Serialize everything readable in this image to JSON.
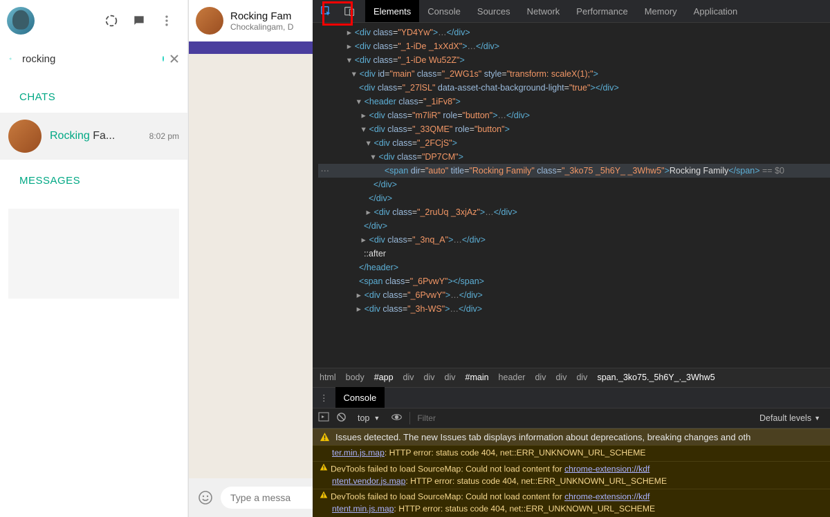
{
  "whatsapp": {
    "search": {
      "value": "rocking"
    },
    "sections": {
      "chats": "CHATS",
      "messages": "MESSAGES"
    },
    "chatItem": {
      "prefix": "Rocking",
      "rest": " Fa...",
      "time": "8:02 pm"
    },
    "openChat": {
      "title": "Rocking Fam",
      "subtitle": "Chockalingam, D"
    },
    "input": {
      "placeholder": "Type a messa"
    }
  },
  "devtools": {
    "tabs": [
      "Elements",
      "Console",
      "Sources",
      "Network",
      "Performance",
      "Memory",
      "Application"
    ],
    "activeTab": "Elements",
    "breadcrumb": [
      "html",
      "body",
      "#app",
      "div",
      "div",
      "div",
      "#main",
      "header",
      "div",
      "div",
      "div",
      "span._3ko75._5h6Y_._3Whw5"
    ],
    "breadcrumbHighlight": [
      2,
      6,
      11
    ],
    "drawerTab": "Console",
    "consoleCtrl": {
      "context": "top",
      "filterPlaceholder": "Filter",
      "levels": "Default levels"
    },
    "issue": "Issues detected. The new Issues tab displays information about deprecations, breaking changes and oth",
    "warnings": [
      {
        "linkPre": "ter.min.js.map",
        "msg": ": HTTP error: status code 404, net::ERR_UNKNOWN_URL_SCHEME"
      },
      {
        "full": "DevTools failed to load SourceMap: Could not load content for ",
        "link": "chrome-extension://kdf",
        "cont": "ntent.vendor.js.map",
        "msg": ": HTTP error: status code 404, net::ERR_UNKNOWN_URL_SCHEME"
      },
      {
        "full": "DevTools failed to load SourceMap: Could not load content for ",
        "link": "chrome-extension://kdf",
        "cont": "ntent.min.js.map",
        "msg": ": HTTP error: status code 404, net::ERR_UNKNOWN_URL_SCHEME"
      }
    ],
    "dom": {
      "l1": {
        "cls": "YD4Yw"
      },
      "l2": {
        "cls": "_1-iDe _1xXdX"
      },
      "l3": {
        "cls": "_1-iDe Wu52Z"
      },
      "l4": {
        "id": "main",
        "cls": "_2WG1s",
        "style": "transform: scaleX(1);"
      },
      "l5": {
        "cls": "_27lSL",
        "dataAttr": "data-asset-chat-background-light",
        "dataVal": "true"
      },
      "l6": {
        "cls": "_1iFv8"
      },
      "l7": {
        "cls": "m7liR",
        "role": "button"
      },
      "l8": {
        "cls": "_33QME",
        "role": "button"
      },
      "l9": {
        "cls": "_2FCjS"
      },
      "l10": {
        "cls": "DP7CM"
      },
      "l11": {
        "title": "Rocking Family",
        "cls": "_3ko75 _5h6Y_ _3Whw5",
        "text": "Rocking Family",
        "eq0": " == $0"
      },
      "l12": {
        "cls": "_2ruUq _3xjAz"
      },
      "l13": {
        "cls": "_3nq_A"
      },
      "l14": "::after",
      "l15": {
        "cls": "_6PvwY"
      },
      "l16": {
        "cls": "_6PvwY"
      },
      "l17": {
        "cls": "_3h-WS"
      }
    }
  }
}
